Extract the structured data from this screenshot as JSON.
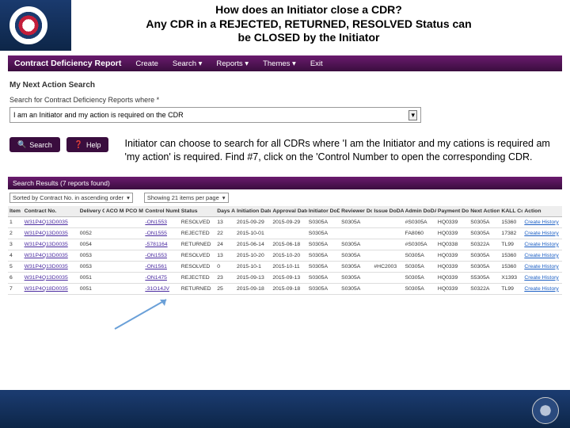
{
  "slide": {
    "title_line1": "How does an Initiator close a CDR?",
    "title_line2": "Any CDR in a REJECTED, RETURNED, RESOLVED Status can",
    "title_line3": "be CLOSED by the Initiator"
  },
  "app": {
    "brand": "Contract Deficiency Report",
    "nav": [
      "Create",
      "Search ▾",
      "Reports ▾",
      "Themes ▾",
      "Exit"
    ]
  },
  "search": {
    "heading": "My Next Action Search",
    "label": "Search for Contract Deficiency Reports where *",
    "selected": "I am an Initiator and my action is required on the CDR",
    "btn_search": "Search",
    "btn_help": "Help"
  },
  "explain": "Initiator can choose to search for all CDRs where 'I am the Initiator and my cations is required am 'my action' is required. Find #7, click on the 'Control Number to open the corresponding CDR.",
  "results": {
    "header": "Search Results (7 reports found)",
    "sort_label": "Sorted by Contract No. in ascending order",
    "page_label": "Showing 21 items per page",
    "columns": [
      "Item",
      "Contract No.",
      "Delivery Order",
      "ACO Mod",
      "PCO Mod",
      "Control Number",
      "Status",
      "Days Aged",
      "Initiation Date",
      "Approval Date",
      "Initiator DoDAAC",
      "Reviewer DoDAAC",
      "Issue DoDAAC",
      "Admin DoDAAC",
      "Payment DoDAAC",
      "Next Action By",
      "KALL Code",
      "Action"
    ],
    "rows": [
      {
        "c": [
          "1",
          "W31P4Q13D0035",
          "",
          "",
          "",
          "-ON1553",
          "RESOLVED",
          "13",
          "2015-09-29",
          "2015-09-29",
          "S0305A",
          "S0305A",
          "",
          "#S0305A",
          "HQ0339",
          "S0305A",
          "15360",
          "Create History"
        ]
      },
      {
        "c": [
          "2",
          "W31P4Q13D0035",
          "0052",
          "",
          "",
          "-ON1555",
          "REJECTED",
          "22",
          "2015-10-01",
          "",
          "S0305A",
          "",
          "",
          "FA8060",
          "HQ0339",
          "S0305A",
          "17382",
          "Create History"
        ]
      },
      {
        "c": [
          "3",
          "W31P4Q13D0035",
          "0054",
          "",
          "",
          "-5781164",
          "RETURNED",
          "24",
          "2015-06-14",
          "2015-06-18",
          "S0305A",
          "S0305A",
          "",
          "#S0305A",
          "HQ0338",
          "S0322A",
          "TL99",
          "Create History"
        ]
      },
      {
        "c": [
          "4",
          "W31P4Q13D0035",
          "0053",
          "",
          "",
          "-ON1553",
          "RESOLVED",
          "13",
          "2015-10-20",
          "2015-10-20",
          "S0305A",
          "S0305A",
          "",
          "S0305A",
          "HQ0339",
          "S0305A",
          "15360",
          "Create History"
        ]
      },
      {
        "c": [
          "5",
          "W31P4Q13D0035",
          "0053",
          "",
          "",
          "-ON1561",
          "RESOLVED",
          "0",
          "2015-10-1",
          "2015-10-11",
          "S0305A",
          "S0305A",
          "#HC2003",
          "S0305A",
          "HQ0339",
          "S0305A",
          "15360",
          "Create History"
        ]
      },
      {
        "c": [
          "6",
          "W31P4Q13D0035",
          "0051",
          "",
          "",
          "-ON1475",
          "REJECTED",
          "23",
          "2015-09-13",
          "2015-09-13",
          "S0305A",
          "S0305A",
          "",
          "S0305A",
          "HQ0339",
          "S5305A",
          "X1393",
          "Create History"
        ]
      },
      {
        "c": [
          "7",
          "W31P4Q18D0035",
          "0051",
          "",
          "",
          "-31O14JV",
          "RETURNED",
          "25",
          "2015-09-18",
          "2015-09-18",
          "S0305A",
          "S0305A",
          "",
          "S0305A",
          "HQ0339",
          "S0322A",
          "TL99",
          "Create History"
        ]
      }
    ]
  }
}
